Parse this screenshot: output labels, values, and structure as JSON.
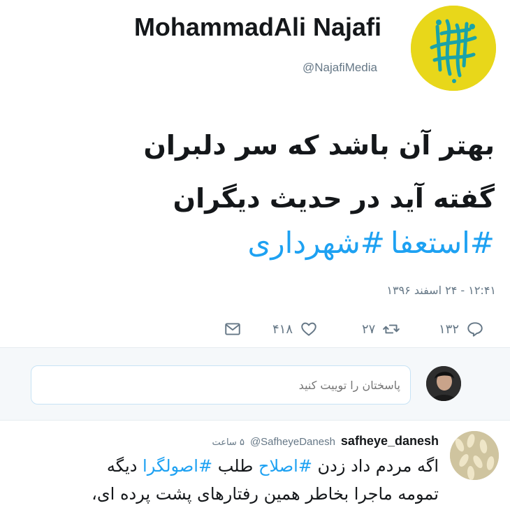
{
  "tweet": {
    "display_name": "MohammadAli Najafi",
    "username": "@NajafiMedia",
    "text_line1": "بهتر آن باشد که سر دلبران",
    "text_line2": "گفته آید در حدیث دیگران",
    "hashtag1": "#استعفا",
    "hashtag2": "#شهرداری",
    "timestamp": "۱۲:۴۱ - ۲۴ اسفند ۱۳۹۶",
    "reply_count": "۱۳۲",
    "retweet_count": "۲۷",
    "like_count": "۴۱۸",
    "colors": {
      "link": "#1da1f2",
      "avatar_bg": "#e8d71a",
      "avatar_art": "#1aa3a8"
    }
  },
  "reply_box": {
    "placeholder": "پاسختان را توییت کنید"
  },
  "reply_tweet": {
    "name": "safheye_danesh",
    "handle": "@SafheyeDanesh",
    "time": "۵ ساعت",
    "text_prefix": "اگه مردم داد زدن ",
    "hashtag1": "#اصلاح",
    "text_mid": " طلب ",
    "hashtag2": "#اصولگرا",
    "text_suffix": " دیگه",
    "text_line2": "تمومه ماجرا بخاطر همین رفتارهای پشت پرده ای،"
  },
  "icons": {
    "reply": "reply-icon",
    "retweet": "retweet-icon",
    "like": "heart-icon",
    "message": "envelope-icon"
  }
}
